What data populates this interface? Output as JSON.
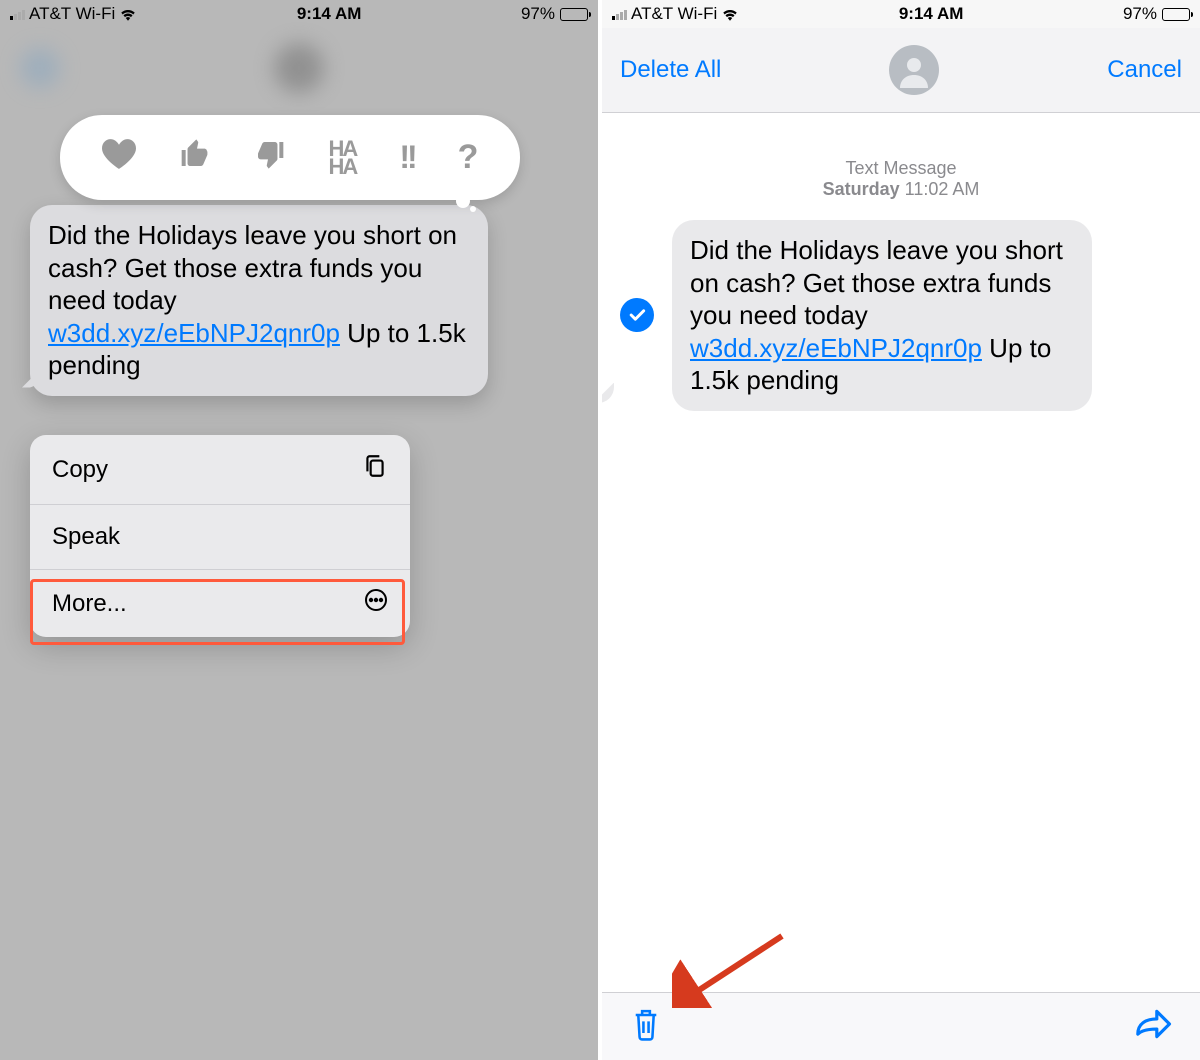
{
  "status": {
    "carrier": "AT&T Wi-Fi",
    "time": "9:14 AM",
    "battery_pct": "97%"
  },
  "message": {
    "text_before_link": "Did the Holidays leave you short on cash? Get those extra funds you need today ",
    "link_text": "w3dd.xyz/eEbNPJ2qnr0p",
    "text_after_link": " Up to 1.5k pending"
  },
  "tapback_reactions": [
    "heart",
    "thumbs-up",
    "thumbs-down",
    "haha",
    "exclaim",
    "question"
  ],
  "context_menu": {
    "copy": "Copy",
    "speak": "Speak",
    "more": "More..."
  },
  "right": {
    "delete_all": "Delete All",
    "cancel": "Cancel",
    "meta_label": "Text Message",
    "meta_day": "Saturday",
    "meta_time": "11:02 AM"
  },
  "colors": {
    "ios_blue": "#007aff",
    "highlight": "#ff5a3c"
  }
}
